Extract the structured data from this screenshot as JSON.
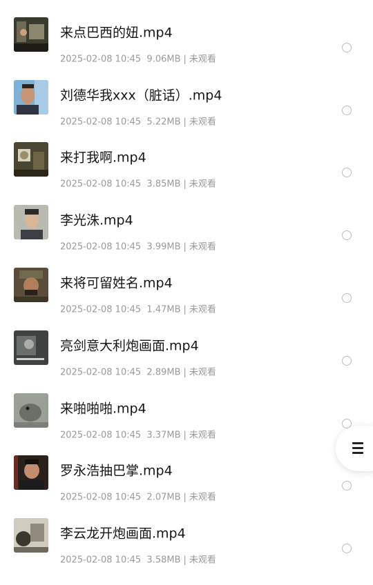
{
  "files": [
    {
      "name": "来点巴西的妞.mp4",
      "date": "2025-02-08 10:45",
      "size": "9.06MB",
      "status": "未观看"
    },
    {
      "name": "刘德华我xxx（脏话）.mp4",
      "date": "2025-02-08 10:45",
      "size": "5.22MB",
      "status": "未观看"
    },
    {
      "name": "来打我啊.mp4",
      "date": "2025-02-08 10:45",
      "size": "3.85MB",
      "status": "未观看"
    },
    {
      "name": "李光洙.mp4",
      "date": "2025-02-08 10:45",
      "size": "3.99MB",
      "status": "未观看"
    },
    {
      "name": "来将可留姓名.mp4",
      "date": "2025-02-08 10:45",
      "size": "1.47MB",
      "status": "未观看"
    },
    {
      "name": "亮剑意大利炮画面.mp4",
      "date": "2025-02-08 10:45",
      "size": "2.89MB",
      "status": "未观看"
    },
    {
      "name": "来啪啪啪.mp4",
      "date": "2025-02-08 10:45",
      "size": "3.37MB",
      "status": "未观看"
    },
    {
      "name": "罗永浩抽巴掌.mp4",
      "date": "2025-02-08 10:45",
      "size": "2.07MB",
      "status": "未观看"
    },
    {
      "name": "李云龙开炮画面.mp4",
      "date": "2025-02-08 10:45",
      "size": "3.58MB",
      "status": "未观看"
    }
  ],
  "meta_separator": "|",
  "fab": {
    "icon": "menu-icon"
  },
  "colors": {
    "title": "#161616",
    "meta": "#9a9a9a",
    "radio": "#bdbdbd"
  }
}
